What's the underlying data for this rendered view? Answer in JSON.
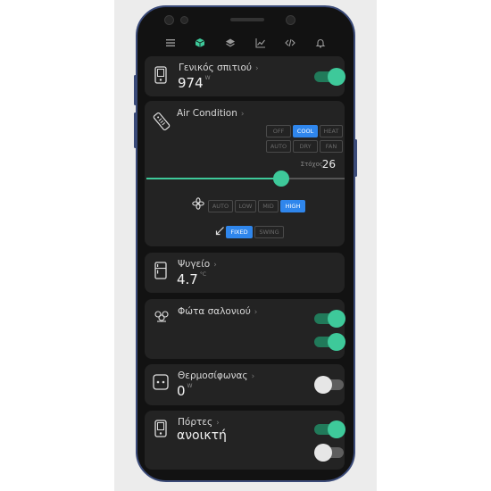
{
  "colors": {
    "accent": "#3ec99a",
    "active_button": "#2f86ec",
    "card": "#232323"
  },
  "nav": [
    {
      "icon": "menu-icon",
      "active": false
    },
    {
      "icon": "cube-icon",
      "active": true
    },
    {
      "icon": "layers-icon",
      "active": false
    },
    {
      "icon": "chart-icon",
      "active": false
    },
    {
      "icon": "code-icon",
      "active": false
    },
    {
      "icon": "bell-icon",
      "active": false
    }
  ],
  "power": {
    "title": "Γενικός σπιτιού",
    "value": "974",
    "unit": "W",
    "icon": "phone-device-icon",
    "on": true
  },
  "ac": {
    "title": "Air Condition",
    "icon": "remote-icon",
    "modes": [
      "OFF",
      "COOL",
      "HEAT",
      "AUTO",
      "DRY",
      "FAN"
    ],
    "mode_selected": "COOL",
    "target_label": "Στόχος",
    "target_value": "26",
    "slider_fraction": 0.68,
    "fan_speeds": [
      "AUTO",
      "LOW",
      "MID",
      "HIGH"
    ],
    "fan_selected": "HIGH",
    "swing": [
      "FIXED",
      "SWING"
    ],
    "swing_selected": "FIXED"
  },
  "fridge": {
    "title": "Ψυγείο",
    "value": "4.7",
    "unit": "°C",
    "icon": "fridge-icon"
  },
  "lights": {
    "title": "Φώτα σαλονιού",
    "icon": "lights-icon",
    "toggle1_on": true,
    "toggle2_on": true
  },
  "heater": {
    "title": "Θερμοσίφωνας",
    "value": "0",
    "unit": "W",
    "icon": "heater-icon",
    "on": false
  },
  "doors": {
    "title": "Πόρτες",
    "value": "ανοικτή",
    "icon": "door-icon",
    "toggle1_on": true,
    "toggle2_on": false
  }
}
